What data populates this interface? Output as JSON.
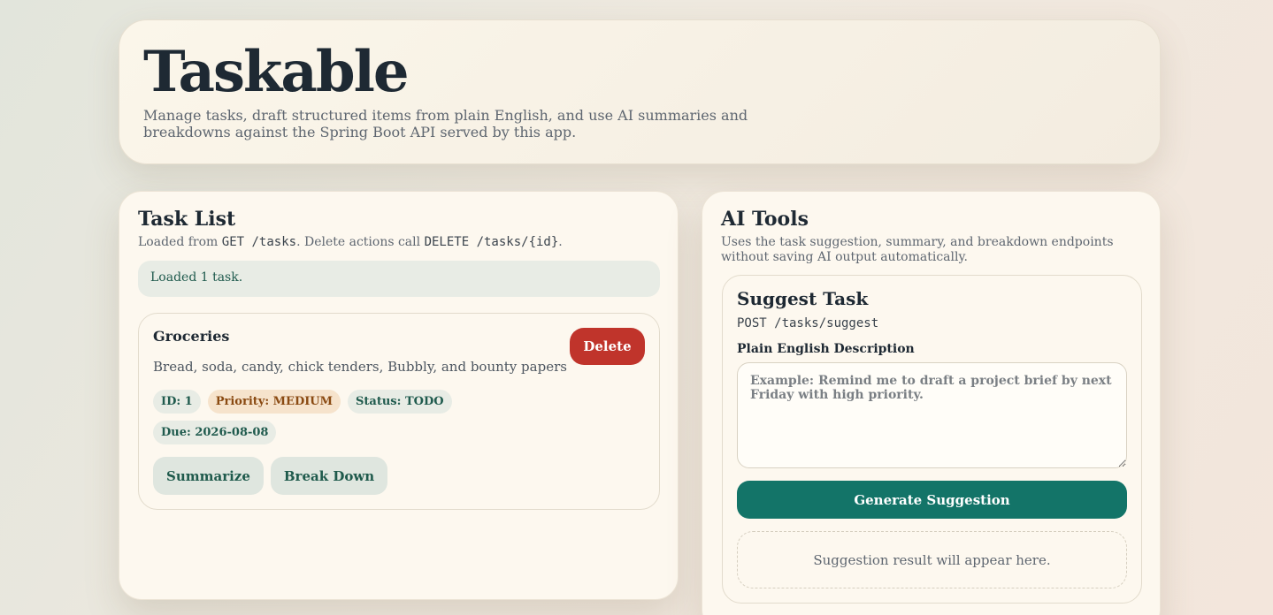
{
  "app": {
    "title": "Taskable",
    "description": "Manage tasks, draft structured items from plain English, and use AI summaries and breakdowns against the Spring Boot API served by this app."
  },
  "task_list": {
    "title": "Task List",
    "sub_prefix": "Loaded from ",
    "sub_get": "GET /tasks",
    "sub_middle": ". Delete actions call ",
    "sub_delete": "DELETE /tasks/{id}",
    "sub_suffix": ".",
    "status": "Loaded 1 task.",
    "tasks": [
      {
        "title": "Groceries",
        "description": "Bread, soda, candy, chick tenders, Bubbly, and bounty papers",
        "id_chip": "ID: 1",
        "priority_chip": "Priority: MEDIUM",
        "status_chip": "Status: TODO",
        "due_chip": "Due: 2026-08-08",
        "delete_label": "Delete",
        "summarize_label": "Summarize",
        "breakdown_label": "Break Down"
      }
    ]
  },
  "ai_tools": {
    "title": "AI Tools",
    "subtitle": "Uses the task suggestion, summary, and breakdown endpoints without saving AI output automatically.",
    "suggest": {
      "title": "Suggest Task",
      "endpoint": "POST /tasks/suggest",
      "field_label": "Plain English Description",
      "placeholder": "Example: Remind me to draft a project brief by next Friday with high priority.",
      "value": "",
      "button_label": "Generate Suggestion",
      "result_placeholder": "Suggestion result will appear here."
    }
  },
  "colors": {
    "accent": "#137468",
    "danger": "#c0342b",
    "priority_bg": "#f6e3cc",
    "chip_bg": "#e8ece5"
  }
}
